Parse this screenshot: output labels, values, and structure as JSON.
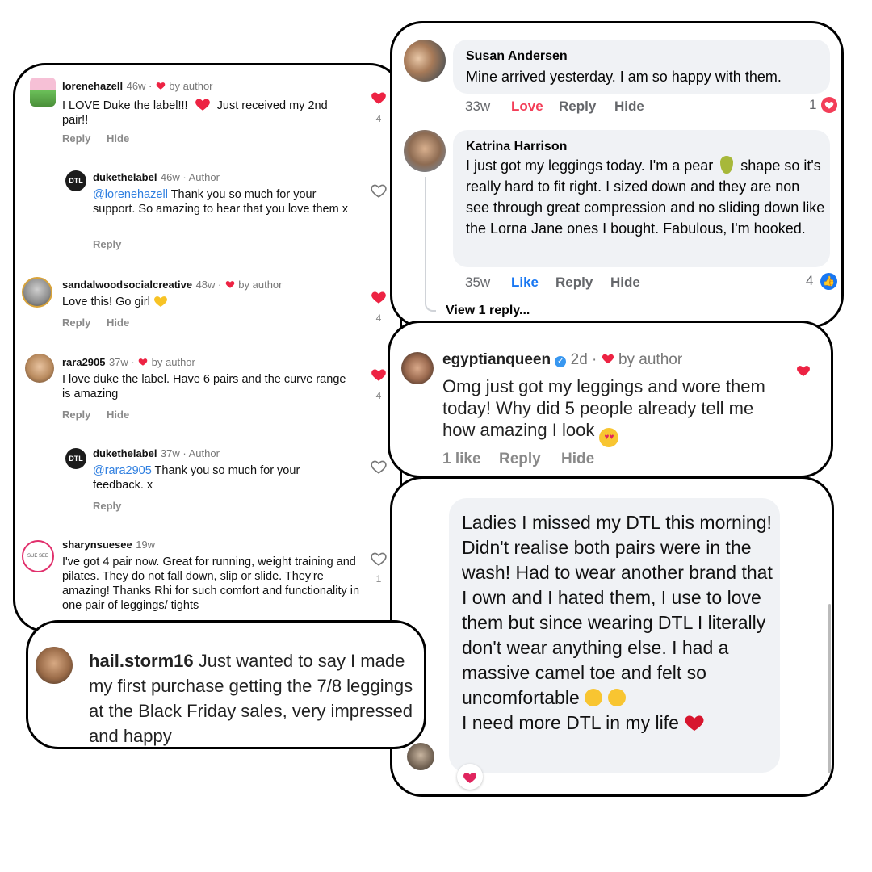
{
  "instagram": {
    "comments": [
      {
        "user": "lorenehazell",
        "meta": "46w ·",
        "by_author": "by author",
        "text": "I LOVE Duke the label!!!",
        "text2": "Just received my 2nd pair!!",
        "likes": "4",
        "reply": "Reply",
        "hide": "Hide"
      },
      {
        "user": "dukethelabel",
        "meta": "46w · Author",
        "mention": "@lorenehazell",
        "text": "Thank you so much for your support. So amazing to hear that you love them x",
        "reply": "Reply"
      },
      {
        "user": "sandalwoodsocialcreative",
        "meta": "48w ·",
        "by_author": "by author",
        "text": "Love this! Go girl",
        "likes": "4",
        "reply": "Reply",
        "hide": "Hide"
      },
      {
        "user": "rara2905",
        "meta": "37w ·",
        "by_author": "by author",
        "text": "I love duke the label. Have 6 pairs and the curve range is amazing",
        "likes": "4",
        "reply": "Reply",
        "hide": "Hide"
      },
      {
        "user": "dukethelabel",
        "meta": "37w · Author",
        "mention": "@rara2905",
        "text": "Thank you so much for your feedback. x",
        "reply": "Reply"
      },
      {
        "user": "sharynsuesee",
        "meta": "19w",
        "text": "I've got 4 pair now. Great for running, weight training and pilates. They do not fall down, slip or slide. They're amazing! Thanks Rhi for such comfort and functionality in one pair of leggings/ tights",
        "likes": "1"
      }
    ]
  },
  "hailstorm": {
    "user": "hail.storm16",
    "text": "Just wanted to say I made my first purchase getting the 7/8 leggings at the Black Friday sales, very impressed and happy"
  },
  "facebook": {
    "comments": [
      {
        "name": "Susan Andersen",
        "text": "Mine arrived yesterday. I am so happy with them.",
        "time": "33w",
        "reaction_label": "Love",
        "reply": "Reply",
        "hide": "Hide",
        "count": "1"
      },
      {
        "name": "Katrina Harrison",
        "text_a": "I just got my leggings today. I'm a pear",
        "text_b": "shape so it's really hard to fit right. I sized down and they are non see through great compression and no sliding down like the Lorna Jane ones I bought. Fabulous, I'm hooked.",
        "time": "35w",
        "reaction_label": "Like",
        "reply": "Reply",
        "hide": "Hide",
        "count": "4"
      }
    ],
    "view_replies": "View 1 reply..."
  },
  "egyptian": {
    "user": "egyptianqueen",
    "time": "2d ·",
    "by_author": "by author",
    "text": "Omg just got my leggings and wore them today! Why did 5 people already tell me how amazing I look",
    "likes": "1 like",
    "reply": "Reply",
    "hide": "Hide"
  },
  "dtl_message": {
    "text": "Ladies I missed my DTL this morning! Didn't realise both pairs were in the wash! Had to wear another brand that I own and I hated them, I use to love them but since wearing DTL I literally don't wear anything else. I had a massive camel toe and felt so uncomfortable",
    "text2": "I need more DTL in my life"
  },
  "colors": {
    "heart": "#ed2343",
    "fb_blue": "#1877f2",
    "fb_love": "#f33e58",
    "bubble": "#f0f2f5"
  },
  "icons": [
    "heart-icon",
    "heart-outline-icon",
    "verified-badge-icon",
    "love-reaction-icon",
    "like-reaction-icon",
    "pear-emoji",
    "heart-eyes-emoji",
    "teary-emoji",
    "tired-emoji",
    "yellow-heart-emoji"
  ]
}
